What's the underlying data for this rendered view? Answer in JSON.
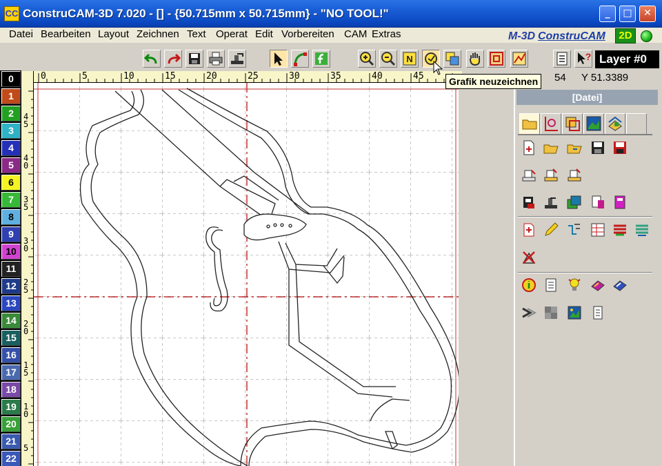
{
  "window": {
    "title": "ConstruCAM-3D 7.020 - [] - {50.715mm x 50.715mm} - \"NO TOOL!\"",
    "app_icon": "CC",
    "min_glyph": "_",
    "max_glyph": "□",
    "close_glyph": "✕"
  },
  "menu": {
    "items": [
      "Datei",
      "Bearbeiten",
      "Layout",
      "Zeichnen",
      "Text",
      "Operat",
      "Edit",
      "Vorbereiten",
      "CAM",
      "Extras"
    ],
    "brand_fragment": "M-3D",
    "brand": "ConstruCAM",
    "mode": "2D"
  },
  "toolbar": {
    "buttons": [
      "undo-icon",
      "redo-icon",
      "save-icon",
      "print-icon",
      "export-icon",
      "select-arrow-icon",
      "node-edit-icon",
      "function-icon",
      "zoom-in-icon",
      "zoom-out-icon",
      "zoom-normal-icon",
      "redraw-icon",
      "zoom-window-icon",
      "pan-hand-icon",
      "zoom-fit-icon",
      "snap-icon",
      "list-icon",
      "help-pointer-icon"
    ],
    "zoom_normal_letter": "N",
    "help_glyph": "?",
    "layer_label": "Layer #0",
    "tooltip": "Grafik neuzeichnen"
  },
  "status": {
    "x_fragment": "54",
    "y_label": "Y 51.3389"
  },
  "palette": {
    "swatches": [
      {
        "label": "0",
        "bg": "#000000",
        "fg": "#ffffff"
      },
      {
        "label": "1",
        "bg": "#c04a1a",
        "fg": "#ffffff"
      },
      {
        "label": "2",
        "bg": "#23a023",
        "fg": "#ffffff"
      },
      {
        "label": "3",
        "bg": "#2fb2c6",
        "fg": "#ffffff"
      },
      {
        "label": "4",
        "bg": "#2530b8",
        "fg": "#ffffff"
      },
      {
        "label": "5",
        "bg": "#8a2a86",
        "fg": "#ffffff"
      },
      {
        "label": "6",
        "bg": "#f4f424",
        "fg": "#000000"
      },
      {
        "label": "7",
        "bg": "#38b838",
        "fg": "#ffffff"
      },
      {
        "label": "8",
        "bg": "#5fb0e0",
        "fg": "#000000"
      },
      {
        "label": "9",
        "bg": "#3040b0",
        "fg": "#ffffff"
      },
      {
        "label": "10",
        "bg": "#d043d0",
        "fg": "#000000"
      },
      {
        "label": "11",
        "bg": "#222222",
        "fg": "#ffffff"
      },
      {
        "label": "12",
        "bg": "#1e3a8a",
        "fg": "#ffffff"
      },
      {
        "label": "13",
        "bg": "#2a46c0",
        "fg": "#ffffff"
      },
      {
        "label": "14",
        "bg": "#3a8a3a",
        "fg": "#ffffff"
      },
      {
        "label": "15",
        "bg": "#1a5f5f",
        "fg": "#ffffff"
      },
      {
        "label": "16",
        "bg": "#3550a8",
        "fg": "#ffffff"
      },
      {
        "label": "17",
        "bg": "#4a6ab0",
        "fg": "#ffffff"
      },
      {
        "label": "18",
        "bg": "#7a4aa8",
        "fg": "#ffffff"
      },
      {
        "label": "19",
        "bg": "#2a7a4a",
        "fg": "#ffffff"
      },
      {
        "label": "20",
        "bg": "#38a038",
        "fg": "#ffffff"
      },
      {
        "label": "21",
        "bg": "#3a5ab0",
        "fg": "#ffffff"
      },
      {
        "label": "22",
        "bg": "#3a58b8",
        "fg": "#ffffff"
      }
    ]
  },
  "rulers": {
    "horizontal": [
      "0",
      "5",
      "10",
      "15",
      "20",
      "25",
      "30",
      "35",
      "40",
      "45"
    ],
    "vertical": [
      "45",
      "40",
      "35",
      "30",
      "25",
      "20",
      "15",
      "10",
      "5"
    ]
  },
  "panel": {
    "header": "[Datei]",
    "tabs": [
      "file-tab-icon",
      "geometry-tab-icon",
      "transform-tab-icon",
      "image-tab-icon",
      "layers-tab-icon",
      "empty-tab"
    ],
    "icon_rows": [
      [
        "new-file-icon",
        "open-file-icon",
        "open-folder-icon",
        "save-file-icon",
        "save-as-icon"
      ],
      [
        "import-icon",
        "import-dxf-icon",
        "import-hpgl-icon"
      ],
      [
        "scan-icon",
        "export-file-icon",
        "copy-layers-icon",
        "export-pdf-icon",
        "export-color-icon"
      ],
      [
        "insert-object-icon",
        "pencil-icon",
        "path-icon",
        "table-icon",
        "stack-icon",
        "layers-stack-icon"
      ],
      [
        "delete-icon"
      ],
      [
        "info-icon",
        "document-icon",
        "bulb-icon",
        "book-icon",
        "book-blue-icon"
      ],
      [
        "arrow-right-icon",
        "texture-icon",
        "picture-icon",
        "notes-icon"
      ]
    ]
  }
}
